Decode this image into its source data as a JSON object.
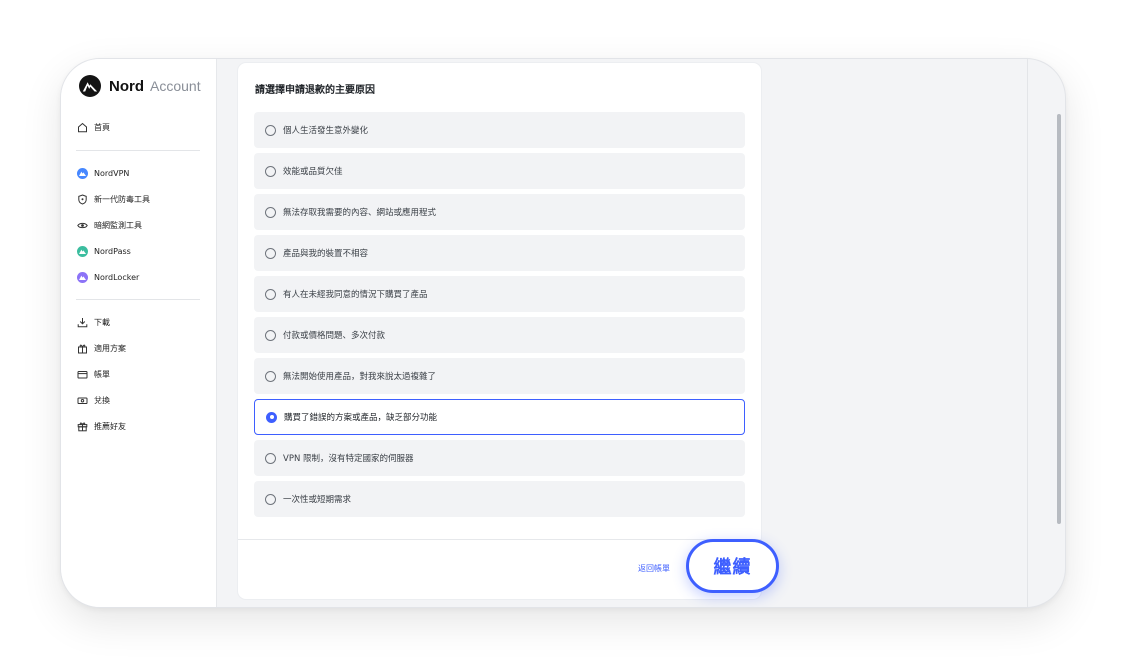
{
  "brand": {
    "name": "Nord",
    "suffix": "Account"
  },
  "sidebar": {
    "home": {
      "label": "首頁",
      "icon": "home-icon"
    },
    "products": [
      {
        "label": "NordVPN",
        "icon": "nordvpn-icon",
        "color": "#4687ff"
      },
      {
        "label": "新一代防毒工具",
        "icon": "shield-icon"
      },
      {
        "label": "暗網監測工具",
        "icon": "eye-icon"
      },
      {
        "label": "NordPass",
        "icon": "nordpass-icon",
        "color": "#3bbd9f"
      },
      {
        "label": "NordLocker",
        "icon": "nordlocker-icon",
        "color": "#8c73f7"
      }
    ],
    "more": [
      {
        "label": "下載",
        "icon": "download-icon"
      },
      {
        "label": "適用方案",
        "icon": "gift-box-icon"
      },
      {
        "label": "帳單",
        "icon": "billing-card-icon"
      },
      {
        "label": "兌換",
        "icon": "redeem-ticket-icon"
      },
      {
        "label": "推薦好友",
        "icon": "gift-icon"
      }
    ]
  },
  "form": {
    "title": "請選擇申請退款的主要原因",
    "options": [
      "個人生活發生意外變化",
      "效能或品質欠佳",
      "無法存取我需要的內容、網站或應用程式",
      "產品與我的裝置不相容",
      "有人在未經我同意的情況下購買了產品",
      "付款或價格問題、多次付款",
      "無法開始使用產品，對我來說太過複雜了",
      "購買了錯誤的方案或產品，缺乏部分功能",
      "VPN 限制，沒有特定國家的伺服器",
      "一次性或短期需求"
    ],
    "selected_index": 7,
    "back_label": "返回帳單",
    "continue_label": "繼續"
  },
  "colors": {
    "accent": "#3e5fff",
    "option_bg": "#f2f3f5",
    "frame_bg": "#f3f4f6"
  }
}
